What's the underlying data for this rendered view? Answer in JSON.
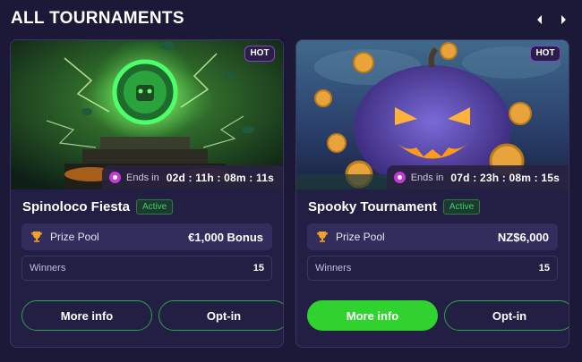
{
  "section": {
    "title": "ALL TOURNAMENTS",
    "prev_icon": "chevron-left-icon",
    "next_icon": "chevron-right-icon"
  },
  "tournaments": [
    {
      "name": "Spinoloco Fiesta",
      "status": "Active",
      "badge": "HOT",
      "ends_label": "Ends in",
      "ends_value": "02d : 11h : 08m : 11s",
      "prize_label": "Prize Pool",
      "prize_value": "€1,000 Bonus",
      "winners_label": "Winners",
      "winners_value": "15",
      "more_info_label": "More info",
      "optin_label": "Opt-in",
      "more_info_style": "outline"
    },
    {
      "name": "Spooky Tournament",
      "status": "Active",
      "badge": "HOT",
      "ends_label": "Ends in",
      "ends_value": "07d : 23h : 08m : 15s",
      "prize_label": "Prize Pool",
      "prize_value": "NZ$6,000",
      "winners_label": "Winners",
      "winners_value": "15",
      "more_info_label": "More info",
      "optin_label": "Opt-in",
      "more_info_style": "solid"
    }
  ],
  "colors": {
    "background": "#1c1838",
    "card": "#221e44",
    "accent_green": "#2fd22f",
    "status_green": "#3ccf6a",
    "hot_border": "#8b3fc9"
  }
}
